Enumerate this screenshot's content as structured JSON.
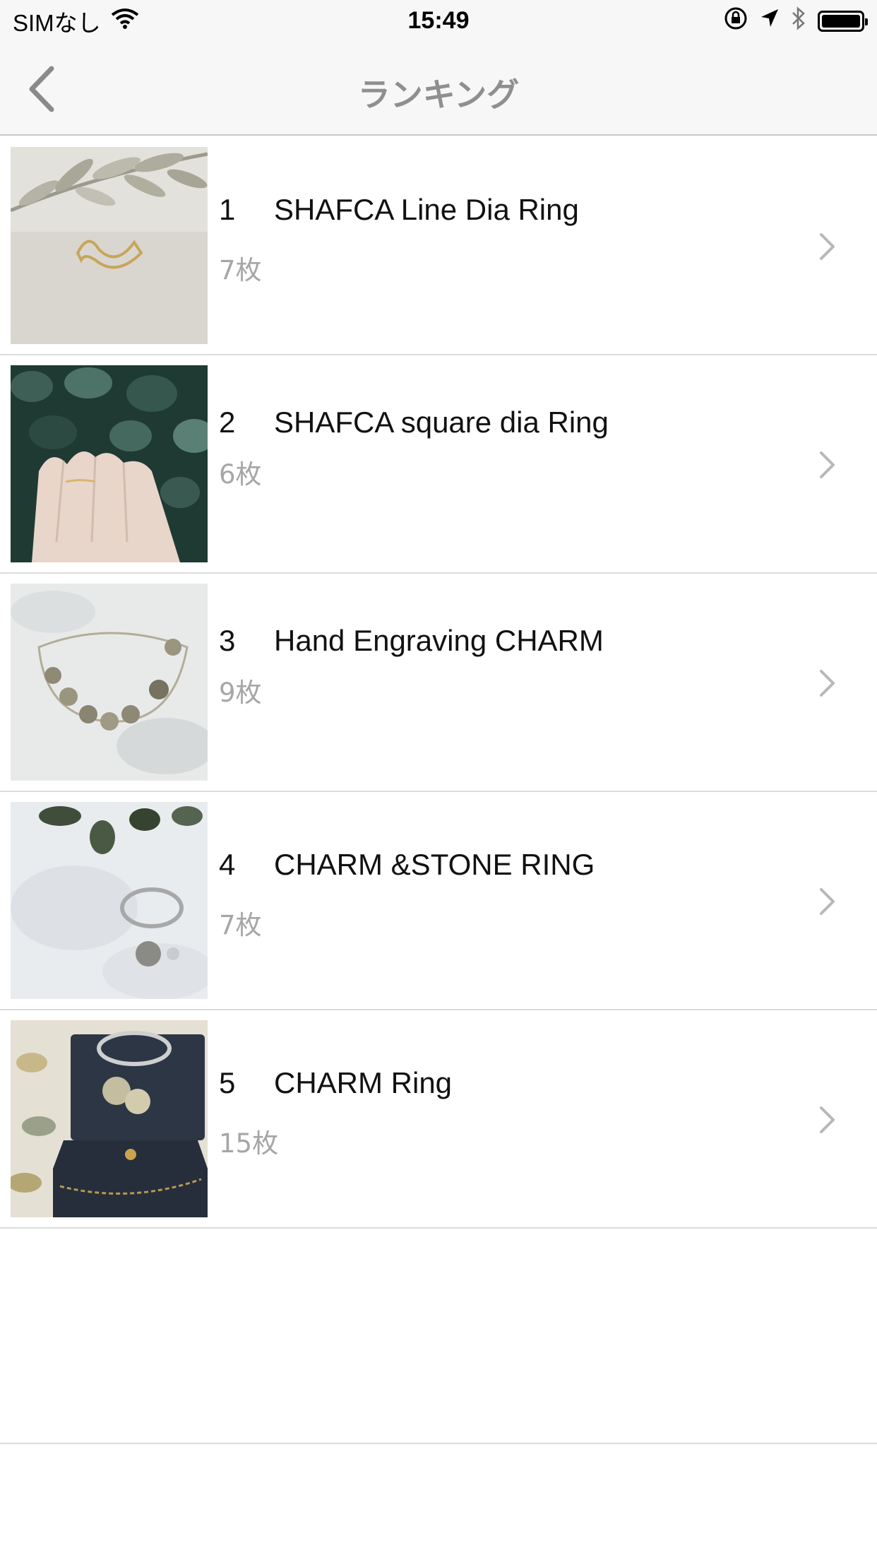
{
  "status_bar": {
    "carrier": "SIMなし",
    "time": "15:49"
  },
  "nav": {
    "title": "ランキング"
  },
  "items": [
    {
      "rank": "1",
      "name": "SHAFCA Line Dia Ring",
      "count": "7枚"
    },
    {
      "rank": "2",
      "name": "SHAFCA square dia Ring",
      "count": "6枚"
    },
    {
      "rank": "3",
      "name": "Hand Engraving CHARM",
      "count": "9枚"
    },
    {
      "rank": "4",
      "name": "CHARM &STONE RING",
      "count": "7枚"
    },
    {
      "rank": "5",
      "name": "CHARM Ring",
      "count": "15枚"
    }
  ]
}
